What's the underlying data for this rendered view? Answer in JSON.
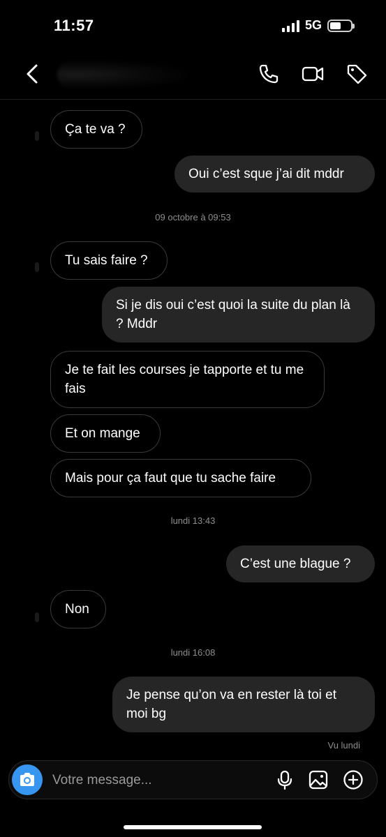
{
  "status": {
    "time": "11:57",
    "network": "5G",
    "battery_level": 0.55
  },
  "header": {
    "back_icon": "chevron-left-icon",
    "call_icon": "phone-icon",
    "video_icon": "video-camera-icon",
    "tag_icon": "tag-icon"
  },
  "messages": [
    {
      "dir": "in",
      "text": "Ça te va ?"
    },
    {
      "dir": "out",
      "text": "Oui c’est sque j’ai dit mddr"
    },
    {
      "type": "stamp",
      "text": "09 octobre à 09:53"
    },
    {
      "dir": "in",
      "text": "Tu sais faire ?"
    },
    {
      "dir": "out",
      "text": "Si je dis oui c’est quoi la suite du plan là ? Mddr"
    },
    {
      "dir": "in",
      "text": "Je te fait les courses je tapporte et tu me fais"
    },
    {
      "dir": "in",
      "text": "Et on mange"
    },
    {
      "dir": "in",
      "text": "Mais pour ça faut que tu sache faire"
    },
    {
      "type": "stamp",
      "text": "lundi 13:43"
    },
    {
      "dir": "out",
      "text": "C’est une blague ?"
    },
    {
      "dir": "in",
      "text": "Non"
    },
    {
      "type": "stamp",
      "text": "lundi 16:08"
    },
    {
      "dir": "out",
      "text": "Je pense qu’on va en rester là toi et moi bg"
    }
  ],
  "seen_label": "Vu lundi",
  "composer": {
    "placeholder": "Votre message...",
    "camera_icon": "camera-icon",
    "mic_icon": "microphone-icon",
    "gallery_icon": "image-icon",
    "plus_icon": "plus-circle-icon"
  },
  "colors": {
    "camera_button": "#3797f0",
    "outgoing_bubble": "#262626",
    "incoming_border": "#3a3a3a"
  }
}
